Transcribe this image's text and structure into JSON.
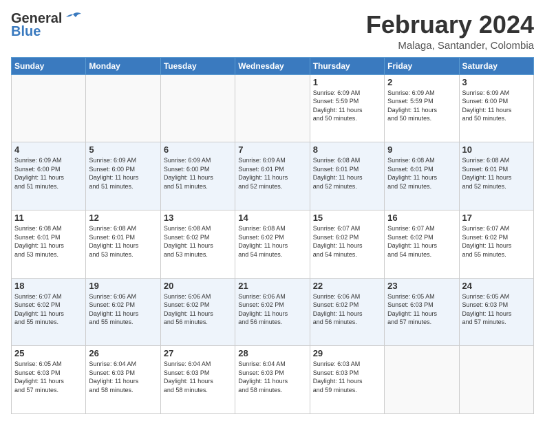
{
  "header": {
    "logo_line1": "General",
    "logo_line2": "Blue",
    "month": "February 2024",
    "location": "Malaga, Santander, Colombia"
  },
  "days_of_week": [
    "Sunday",
    "Monday",
    "Tuesday",
    "Wednesday",
    "Thursday",
    "Friday",
    "Saturday"
  ],
  "weeks": [
    [
      {
        "day": "",
        "info": ""
      },
      {
        "day": "",
        "info": ""
      },
      {
        "day": "",
        "info": ""
      },
      {
        "day": "",
        "info": ""
      },
      {
        "day": "1",
        "info": "Sunrise: 6:09 AM\nSunset: 5:59 PM\nDaylight: 11 hours\nand 50 minutes."
      },
      {
        "day": "2",
        "info": "Sunrise: 6:09 AM\nSunset: 5:59 PM\nDaylight: 11 hours\nand 50 minutes."
      },
      {
        "day": "3",
        "info": "Sunrise: 6:09 AM\nSunset: 6:00 PM\nDaylight: 11 hours\nand 50 minutes."
      }
    ],
    [
      {
        "day": "4",
        "info": "Sunrise: 6:09 AM\nSunset: 6:00 PM\nDaylight: 11 hours\nand 51 minutes."
      },
      {
        "day": "5",
        "info": "Sunrise: 6:09 AM\nSunset: 6:00 PM\nDaylight: 11 hours\nand 51 minutes."
      },
      {
        "day": "6",
        "info": "Sunrise: 6:09 AM\nSunset: 6:00 PM\nDaylight: 11 hours\nand 51 minutes."
      },
      {
        "day": "7",
        "info": "Sunrise: 6:09 AM\nSunset: 6:01 PM\nDaylight: 11 hours\nand 52 minutes."
      },
      {
        "day": "8",
        "info": "Sunrise: 6:08 AM\nSunset: 6:01 PM\nDaylight: 11 hours\nand 52 minutes."
      },
      {
        "day": "9",
        "info": "Sunrise: 6:08 AM\nSunset: 6:01 PM\nDaylight: 11 hours\nand 52 minutes."
      },
      {
        "day": "10",
        "info": "Sunrise: 6:08 AM\nSunset: 6:01 PM\nDaylight: 11 hours\nand 52 minutes."
      }
    ],
    [
      {
        "day": "11",
        "info": "Sunrise: 6:08 AM\nSunset: 6:01 PM\nDaylight: 11 hours\nand 53 minutes."
      },
      {
        "day": "12",
        "info": "Sunrise: 6:08 AM\nSunset: 6:01 PM\nDaylight: 11 hours\nand 53 minutes."
      },
      {
        "day": "13",
        "info": "Sunrise: 6:08 AM\nSunset: 6:02 PM\nDaylight: 11 hours\nand 53 minutes."
      },
      {
        "day": "14",
        "info": "Sunrise: 6:08 AM\nSunset: 6:02 PM\nDaylight: 11 hours\nand 54 minutes."
      },
      {
        "day": "15",
        "info": "Sunrise: 6:07 AM\nSunset: 6:02 PM\nDaylight: 11 hours\nand 54 minutes."
      },
      {
        "day": "16",
        "info": "Sunrise: 6:07 AM\nSunset: 6:02 PM\nDaylight: 11 hours\nand 54 minutes."
      },
      {
        "day": "17",
        "info": "Sunrise: 6:07 AM\nSunset: 6:02 PM\nDaylight: 11 hours\nand 55 minutes."
      }
    ],
    [
      {
        "day": "18",
        "info": "Sunrise: 6:07 AM\nSunset: 6:02 PM\nDaylight: 11 hours\nand 55 minutes."
      },
      {
        "day": "19",
        "info": "Sunrise: 6:06 AM\nSunset: 6:02 PM\nDaylight: 11 hours\nand 55 minutes."
      },
      {
        "day": "20",
        "info": "Sunrise: 6:06 AM\nSunset: 6:02 PM\nDaylight: 11 hours\nand 56 minutes."
      },
      {
        "day": "21",
        "info": "Sunrise: 6:06 AM\nSunset: 6:02 PM\nDaylight: 11 hours\nand 56 minutes."
      },
      {
        "day": "22",
        "info": "Sunrise: 6:06 AM\nSunset: 6:02 PM\nDaylight: 11 hours\nand 56 minutes."
      },
      {
        "day": "23",
        "info": "Sunrise: 6:05 AM\nSunset: 6:03 PM\nDaylight: 11 hours\nand 57 minutes."
      },
      {
        "day": "24",
        "info": "Sunrise: 6:05 AM\nSunset: 6:03 PM\nDaylight: 11 hours\nand 57 minutes."
      }
    ],
    [
      {
        "day": "25",
        "info": "Sunrise: 6:05 AM\nSunset: 6:03 PM\nDaylight: 11 hours\nand 57 minutes."
      },
      {
        "day": "26",
        "info": "Sunrise: 6:04 AM\nSunset: 6:03 PM\nDaylight: 11 hours\nand 58 minutes."
      },
      {
        "day": "27",
        "info": "Sunrise: 6:04 AM\nSunset: 6:03 PM\nDaylight: 11 hours\nand 58 minutes."
      },
      {
        "day": "28",
        "info": "Sunrise: 6:04 AM\nSunset: 6:03 PM\nDaylight: 11 hours\nand 58 minutes."
      },
      {
        "day": "29",
        "info": "Sunrise: 6:03 AM\nSunset: 6:03 PM\nDaylight: 11 hours\nand 59 minutes."
      },
      {
        "day": "",
        "info": ""
      },
      {
        "day": "",
        "info": ""
      }
    ]
  ]
}
